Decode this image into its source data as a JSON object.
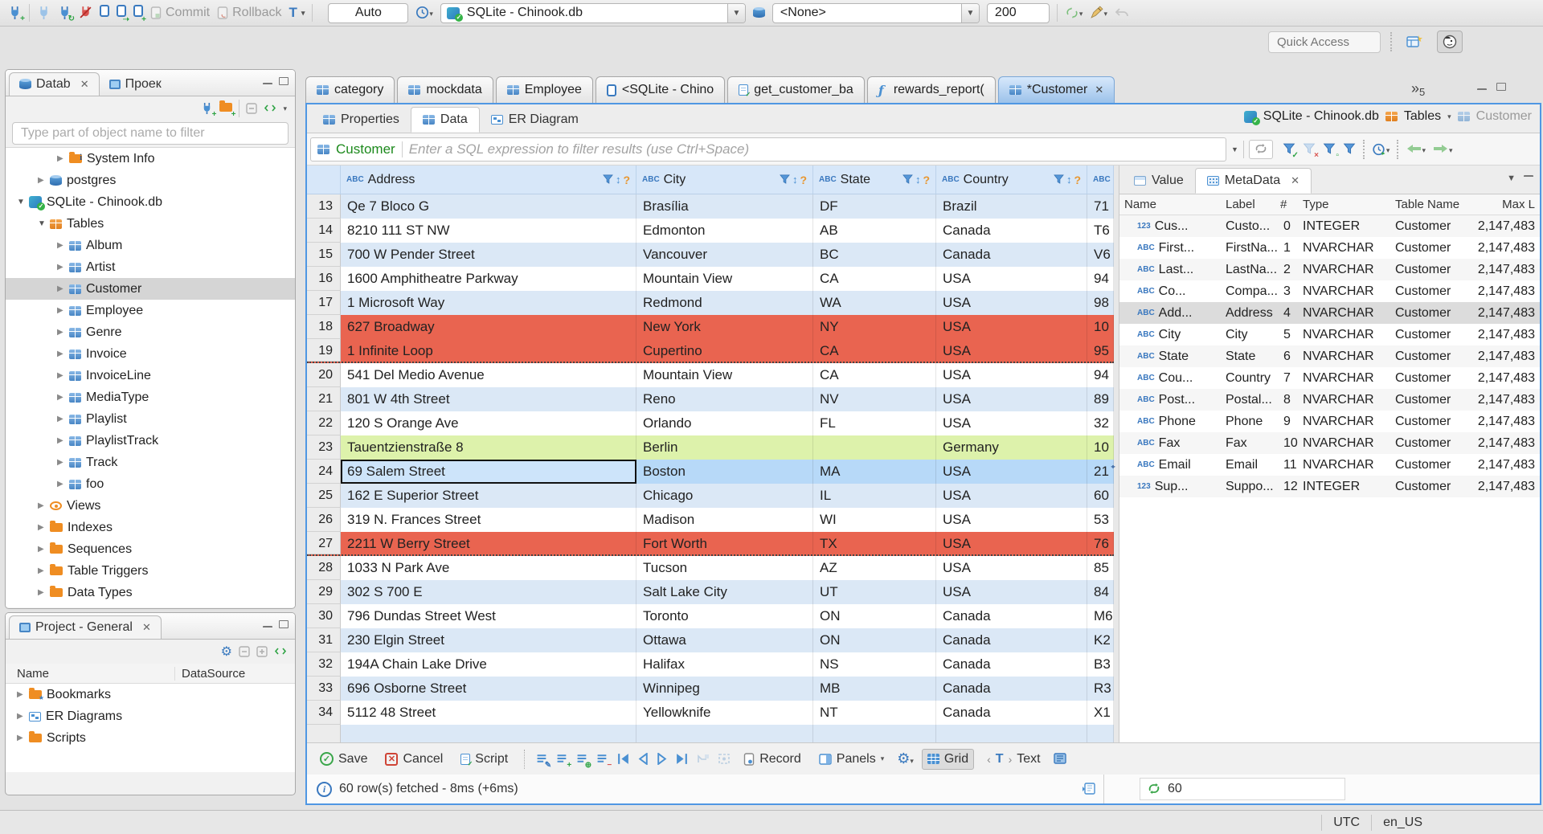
{
  "topbar": {
    "commit": "Commit",
    "rollback": "Rollback",
    "auto": "Auto",
    "connection": "SQLite - Chinook.db",
    "schema": "<None>",
    "fetch_size": "200",
    "quick_access": "Quick Access"
  },
  "sidebar": {
    "tab_db": "Datab",
    "tab_proj": "Проек",
    "filter_placeholder": "Type part of object name to filter",
    "tree": [
      {
        "label": "System Info",
        "lvl": "lvl3",
        "exp": "c",
        "icon": "i-infofolder",
        "cls": ""
      },
      {
        "label": "postgres",
        "lvl": "lvl2",
        "exp": "c",
        "icon": "i-db",
        "cls": ""
      },
      {
        "label": "SQLite - Chinook.db",
        "lvl": "lvl1",
        "exp": "o",
        "icon": "i-sqlite",
        "cls": ""
      },
      {
        "label": "Tables",
        "lvl": "lvl2",
        "exp": "o",
        "icon": "i-tfolder",
        "cls": ""
      },
      {
        "label": "Album",
        "lvl": "lvl3",
        "exp": "c",
        "icon": "i-table",
        "cls": ""
      },
      {
        "label": "Artist",
        "lvl": "lvl3",
        "exp": "c",
        "icon": "i-table",
        "cls": ""
      },
      {
        "label": "Customer",
        "lvl": "lvl3",
        "exp": "c",
        "icon": "i-table",
        "cls": "sel"
      },
      {
        "label": "Employee",
        "lvl": "lvl3",
        "exp": "c",
        "icon": "i-table",
        "cls": ""
      },
      {
        "label": "Genre",
        "lvl": "lvl3",
        "exp": "c",
        "icon": "i-table",
        "cls": ""
      },
      {
        "label": "Invoice",
        "lvl": "lvl3",
        "exp": "c",
        "icon": "i-table",
        "cls": ""
      },
      {
        "label": "InvoiceLine",
        "lvl": "lvl3",
        "exp": "c",
        "icon": "i-table",
        "cls": ""
      },
      {
        "label": "MediaType",
        "lvl": "lvl3",
        "exp": "c",
        "icon": "i-table",
        "cls": ""
      },
      {
        "label": "Playlist",
        "lvl": "lvl3",
        "exp": "c",
        "icon": "i-table",
        "cls": ""
      },
      {
        "label": "PlaylistTrack",
        "lvl": "lvl3",
        "exp": "c",
        "icon": "i-table",
        "cls": ""
      },
      {
        "label": "Track",
        "lvl": "lvl3",
        "exp": "c",
        "icon": "i-table",
        "cls": ""
      },
      {
        "label": "foo",
        "lvl": "lvl3",
        "exp": "c",
        "icon": "i-table",
        "cls": ""
      },
      {
        "label": "Views",
        "lvl": "lvl2",
        "exp": "c",
        "icon": "i-eye",
        "cls": ""
      },
      {
        "label": "Indexes",
        "lvl": "lvl2",
        "exp": "c",
        "icon": "i-folder",
        "cls": ""
      },
      {
        "label": "Sequences",
        "lvl": "lvl2",
        "exp": "c",
        "icon": "i-folder",
        "cls": ""
      },
      {
        "label": "Table Triggers",
        "lvl": "lvl2",
        "exp": "c",
        "icon": "i-folder",
        "cls": ""
      },
      {
        "label": "Data Types",
        "lvl": "lvl2",
        "exp": "c",
        "icon": "i-folder",
        "cls": ""
      }
    ]
  },
  "project_panel": {
    "title": "Project - General",
    "col_name": "Name",
    "col_datasource": "DataSource",
    "items": [
      {
        "label": "Bookmarks",
        "icon": "i-bfolder"
      },
      {
        "label": "ER Diagrams",
        "icon": "i-erd"
      },
      {
        "label": "Scripts",
        "icon": "i-folder"
      }
    ]
  },
  "editor": {
    "tabs": [
      {
        "label": "category",
        "icon": "i-table",
        "cls": ""
      },
      {
        "label": "mockdata",
        "icon": "i-table",
        "cls": ""
      },
      {
        "label": "Employee",
        "icon": "i-table",
        "cls": ""
      },
      {
        "label": "<SQLite - Chino",
        "icon": "i-sql",
        "cls": ""
      },
      {
        "label": "get_customer_ba",
        "icon": "i-script",
        "cls": ""
      },
      {
        "label": "rewards_report(",
        "icon": "i-func",
        "cls": ""
      },
      {
        "label": "*Customer",
        "icon": "i-table",
        "cls": "active"
      }
    ],
    "overflow_count": "5",
    "subtabs": [
      {
        "label": "Properties",
        "icon": "i-table",
        "cls": ""
      },
      {
        "label": "Data",
        "icon": "i-table",
        "cls": "active"
      },
      {
        "label": "ER Diagram",
        "icon": "i-erd",
        "cls": ""
      }
    ],
    "breadcrumb": {
      "db": "SQLite - Chinook.db",
      "tables": "Tables",
      "table": "Customer"
    }
  },
  "filter_bar": {
    "table": "Customer",
    "placeholder": "Enter a SQL expression to filter results (use Ctrl+Space)"
  },
  "grid": {
    "columns": [
      {
        "name": "Address",
        "type_icon": "ABC",
        "w": "c-addr"
      },
      {
        "name": "City",
        "type_icon": "ABC",
        "w": "c-city"
      },
      {
        "name": "State",
        "type_icon": "ABC",
        "w": "c-state"
      },
      {
        "name": "Country",
        "type_icon": "ABC",
        "w": "c-country"
      }
    ],
    "extra_header": {
      "type_icon": "ABC"
    },
    "rows": [
      {
        "num": "13",
        "address": "Qe 7 Bloco G",
        "city": "Brasília",
        "state": "DF",
        "country": "Brazil",
        "extra": "71",
        "cls": "r-alt"
      },
      {
        "num": "14",
        "address": "8210 111 ST NW",
        "city": "Edmonton",
        "state": "AB",
        "country": "Canada",
        "extra": "T6",
        "cls": "r-white"
      },
      {
        "num": "15",
        "address": "700 W Pender Street",
        "city": "Vancouver",
        "state": "BC",
        "country": "Canada",
        "extra": "V6",
        "cls": "r-alt"
      },
      {
        "num": "16",
        "address": "1600 Amphitheatre Parkway",
        "city": "Mountain View",
        "state": "CA",
        "country": "USA",
        "extra": "94",
        "cls": "r-white"
      },
      {
        "num": "17",
        "address": "1 Microsoft Way",
        "city": "Redmond",
        "state": "WA",
        "country": "USA",
        "extra": "98",
        "cls": "r-alt"
      },
      {
        "num": "18",
        "address": "627 Broadway",
        "city": "New York",
        "state": "NY",
        "country": "USA",
        "extra": "10",
        "cls": "r-red"
      },
      {
        "num": "19",
        "address": "1 Infinite Loop",
        "city": "Cupertino",
        "state": "CA",
        "country": "USA",
        "extra": "95",
        "cls": "r-red r-dot"
      },
      {
        "num": "20",
        "address": "541 Del Medio Avenue",
        "city": "Mountain View",
        "state": "CA",
        "country": "USA",
        "extra": "94",
        "cls": "r-white"
      },
      {
        "num": "21",
        "address": "801 W 4th Street",
        "city": "Reno",
        "state": "NV",
        "country": "USA",
        "extra": "89",
        "cls": "r-alt"
      },
      {
        "num": "22",
        "address": "120 S Orange Ave",
        "city": "Orlando",
        "state": "FL",
        "country": "USA",
        "extra": "32",
        "cls": "r-white"
      },
      {
        "num": "23",
        "address": "Tauentzienstraße 8",
        "city": "Berlin",
        "state": "",
        "country": "Germany",
        "extra": "10",
        "cls": "r-green"
      },
      {
        "num": "24",
        "address": "69 Salem Street",
        "city": "Boston",
        "state": "MA",
        "country": "USA",
        "extra": "21",
        "cls": "r-sel"
      },
      {
        "num": "25",
        "address": "162 E Superior Street",
        "city": "Chicago",
        "state": "IL",
        "country": "USA",
        "extra": "60",
        "cls": "r-alt"
      },
      {
        "num": "26",
        "address": "319 N. Frances Street",
        "city": "Madison",
        "state": "WI",
        "country": "USA",
        "extra": "53",
        "cls": "r-white"
      },
      {
        "num": "27",
        "address": "2211 W Berry Street",
        "city": "Fort Worth",
        "state": "TX",
        "country": "USA",
        "extra": "76",
        "cls": "r-red r-dot"
      },
      {
        "num": "28",
        "address": "1033 N Park Ave",
        "city": "Tucson",
        "state": "AZ",
        "country": "USA",
        "extra": "85",
        "cls": "r-white"
      },
      {
        "num": "29",
        "address": "302 S 700 E",
        "city": "Salt Lake City",
        "state": "UT",
        "country": "USA",
        "extra": "84",
        "cls": "r-alt"
      },
      {
        "num": "30",
        "address": "796 Dundas Street West",
        "city": "Toronto",
        "state": "ON",
        "country": "Canada",
        "extra": "M6",
        "cls": "r-white"
      },
      {
        "num": "31",
        "address": "230 Elgin Street",
        "city": "Ottawa",
        "state": "ON",
        "country": "Canada",
        "extra": "K2",
        "cls": "r-alt"
      },
      {
        "num": "32",
        "address": "194A Chain Lake Drive",
        "city": "Halifax",
        "state": "NS",
        "country": "Canada",
        "extra": "B3",
        "cls": "r-white"
      },
      {
        "num": "33",
        "address": "696 Osborne Street",
        "city": "Winnipeg",
        "state": "MB",
        "country": "Canada",
        "extra": "R3",
        "cls": "r-alt"
      },
      {
        "num": "34",
        "address": "5112 48 Street",
        "city": "Yellowknife",
        "state": "NT",
        "country": "Canada",
        "extra": "X1",
        "cls": "r-white"
      }
    ]
  },
  "meta_panel": {
    "tab_value": "Value",
    "tab_meta": "MetaData",
    "columns": [
      {
        "t": "Name",
        "w": "mw-name"
      },
      {
        "t": "Label",
        "w": "mw-label"
      },
      {
        "t": "#",
        "w": "mw-num"
      },
      {
        "t": "Type",
        "w": "mw-type"
      },
      {
        "t": "Table Name",
        "w": "mw-table"
      },
      {
        "t": "Max L",
        "w": "mw-max"
      }
    ],
    "rows": [
      {
        "icon": "123",
        "name": "Cus...",
        "label": "Custo...",
        "num": "0",
        "type": "INTEGER",
        "table": "Customer",
        "max": "2,147,483",
        "cls": ""
      },
      {
        "icon": "ABC",
        "name": "First...",
        "label": "FirstNa...",
        "num": "1",
        "type": "NVARCHAR",
        "table": "Customer",
        "max": "2,147,483",
        "cls": ""
      },
      {
        "icon": "ABC",
        "name": "Last...",
        "label": "LastNa...",
        "num": "2",
        "type": "NVARCHAR",
        "table": "Customer",
        "max": "2,147,483",
        "cls": ""
      },
      {
        "icon": "ABC",
        "name": "Co...",
        "label": "Compa...",
        "num": "3",
        "type": "NVARCHAR",
        "table": "Customer",
        "max": "2,147,483",
        "cls": ""
      },
      {
        "icon": "ABC",
        "name": "Add...",
        "label": "Address",
        "num": "4",
        "type": "NVARCHAR",
        "table": "Customer",
        "max": "2,147,483",
        "cls": "m-sel"
      },
      {
        "icon": "ABC",
        "name": "City",
        "label": "City",
        "num": "5",
        "type": "NVARCHAR",
        "table": "Customer",
        "max": "2,147,483",
        "cls": ""
      },
      {
        "icon": "ABC",
        "name": "State",
        "label": "State",
        "num": "6",
        "type": "NVARCHAR",
        "table": "Customer",
        "max": "2,147,483",
        "cls": ""
      },
      {
        "icon": "ABC",
        "name": "Cou...",
        "label": "Country",
        "num": "7",
        "type": "NVARCHAR",
        "table": "Customer",
        "max": "2,147,483",
        "cls": ""
      },
      {
        "icon": "ABC",
        "name": "Post...",
        "label": "Postal...",
        "num": "8",
        "type": "NVARCHAR",
        "table": "Customer",
        "max": "2,147,483",
        "cls": ""
      },
      {
        "icon": "ABC",
        "name": "Phone",
        "label": "Phone",
        "num": "9",
        "type": "NVARCHAR",
        "table": "Customer",
        "max": "2,147,483",
        "cls": ""
      },
      {
        "icon": "ABC",
        "name": "Fax",
        "label": "Fax",
        "num": "10",
        "type": "NVARCHAR",
        "table": "Customer",
        "max": "2,147,483",
        "cls": ""
      },
      {
        "icon": "ABC",
        "name": "Email",
        "label": "Email",
        "num": "11",
        "type": "NVARCHAR",
        "table": "Customer",
        "max": "2,147,483",
        "cls": ""
      },
      {
        "icon": "123",
        "name": "Sup...",
        "label": "Suppo...",
        "num": "12",
        "type": "INTEGER",
        "table": "Customer",
        "max": "2,147,483",
        "cls": ""
      }
    ]
  },
  "bottom_toolbar": {
    "save": "Save",
    "cancel": "Cancel",
    "script": "Script",
    "record": "Record",
    "panels": "Panels",
    "grid": "Grid",
    "text": "Text"
  },
  "status": {
    "fetch": "60 row(s) fetched - 8ms (+6ms)",
    "count": "60"
  },
  "statusbar": {
    "tz": "UTC",
    "locale": "en_US"
  }
}
